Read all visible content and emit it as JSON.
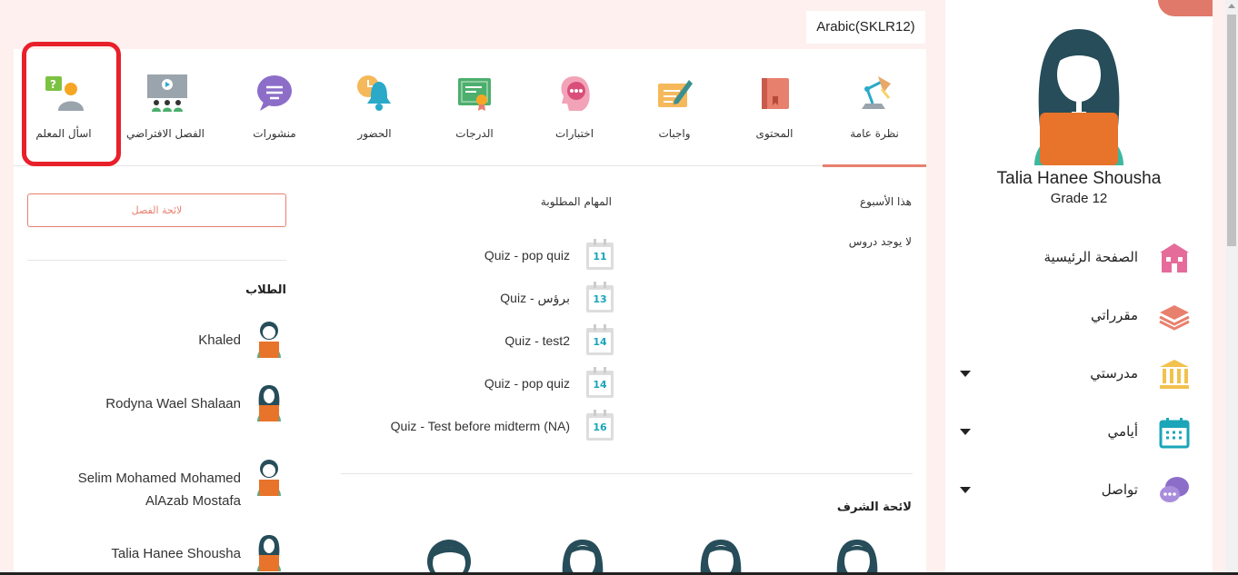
{
  "course": "Arabic(SKLR12)",
  "tabs": [
    {
      "label": "نظرة عامة",
      "icon": "desk-lamp-icon",
      "active": true
    },
    {
      "label": "المحتوى",
      "icon": "book-icon"
    },
    {
      "label": "واجبات",
      "icon": "pen-paper-icon"
    },
    {
      "label": "اختبارات",
      "icon": "quiz-head-icon"
    },
    {
      "label": "الدرجات",
      "icon": "certificate-icon"
    },
    {
      "label": "الحضور",
      "icon": "bell-clock-icon"
    },
    {
      "label": "منشورات",
      "icon": "chat-bubble-icon"
    },
    {
      "label": "الفصل الافتراضي",
      "icon": "virtual-class-icon"
    },
    {
      "label": "اسأل المعلم",
      "icon": "ask-teacher-icon"
    }
  ],
  "overview": {
    "week_title": "هذا الأسبوع",
    "no_lessons": "لا يوجد دروس",
    "tasks_title": "المهام المطلوبة",
    "tasks": [
      {
        "label": "Quiz - pop quiz",
        "day": "11"
      },
      {
        "label": "Quiz - برؤس",
        "day": "13"
      },
      {
        "label": "Quiz - test2",
        "day": "14"
      },
      {
        "label": "Quiz - pop quiz",
        "day": "14"
      },
      {
        "label": "Quiz - Test before midterm (NA)",
        "day": "16"
      }
    ],
    "honor_title": "لائحة الشرف"
  },
  "class_board_button": "لائحة الفصل",
  "students_title": "الطلاب",
  "students": [
    {
      "name": "Khaled",
      "gender": "male"
    },
    {
      "name": "Rodyna Wael Shalaan",
      "gender": "female"
    },
    {
      "name": "Selim Mohamed Mohamed AlAzab Mostafa",
      "gender": "male"
    },
    {
      "name": "Talia Hanee Shousha",
      "gender": "female"
    }
  ],
  "profile": {
    "name": "Talia Hanee Shousha",
    "grade": "Grade 12"
  },
  "nav": [
    {
      "label": "الصفحة الرئيسية",
      "icon": "school-building-icon",
      "dropdown": false
    },
    {
      "label": "مقرراتي",
      "icon": "layers-icon",
      "dropdown": false
    },
    {
      "label": "مدرستي",
      "icon": "institution-icon",
      "dropdown": true
    },
    {
      "label": "أيامي",
      "icon": "calendar-icon",
      "dropdown": true
    },
    {
      "label": "تواصل",
      "icon": "chat-icon",
      "dropdown": true
    }
  ],
  "colors": {
    "accent": "#e8806e",
    "highlight": "#e8202a",
    "teal": "#1aa5b8"
  }
}
